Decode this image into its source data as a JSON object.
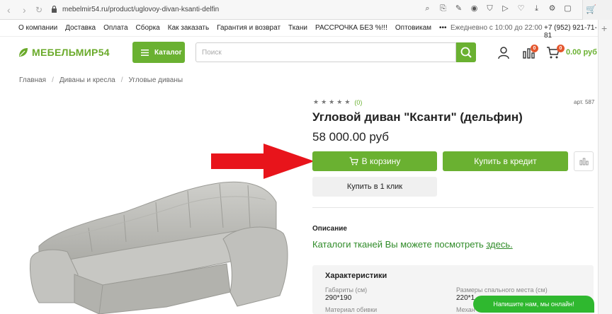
{
  "browser": {
    "url": "mebelmir54.ru/product/uglovoy-divan-ksanti-delfin",
    "back_icon": "back-icon",
    "forward_icon": "forward-icon",
    "reload_icon": "reload-icon"
  },
  "topnav": {
    "links": [
      "О компании",
      "Доставка",
      "Оплата",
      "Сборка",
      "Как заказать",
      "Гарантия и возврат",
      "Ткани",
      "РАССРОЧКА БЕЗ %!!!",
      "Оптовикам",
      "•••"
    ],
    "hours": "Ежедневно с 10:00 до 22:00",
    "phone": "+7 (952) 921-71-81"
  },
  "header": {
    "logo_text": "МЕБЕЛЬМИР54",
    "catalog_label": "Каталог",
    "search_placeholder": "Поиск",
    "compare_badge": "0",
    "cart_badge": "0",
    "cart_sum": "0.00 руб"
  },
  "breadcrumb": [
    "Главная",
    "Диваны и кресла",
    "Угловые диваны"
  ],
  "product": {
    "rating_count": "(0)",
    "rating_stars": 0,
    "sku": "арт. 587",
    "title": "Угловой диван \"Ксанти\" (дельфин)",
    "price": "58 000.00 руб",
    "add_to_cart": "В корзину",
    "buy_credit": "Купить в кредит",
    "buy_one_click": "Купить в 1 клик",
    "description_heading": "Описание",
    "description_text": "Каталоги тканей Вы можете посмотреть ",
    "description_link": "здесь.",
    "specs": {
      "heading": "Характеристики",
      "dims_label": "Габариты (см)",
      "dims_value": "290*190",
      "sleep_label": "Размеры спального места (см)",
      "sleep_value": "220*1",
      "upholstery_label": "Материал обивки",
      "mech_label": "Механ"
    }
  },
  "chat": {
    "label": "Напишите нам, мы онлайн!"
  },
  "colors": {
    "accent": "#6ab131",
    "arrow": "#e8141b",
    "badge": "#e4572e",
    "link": "#2f8b28",
    "chat": "#2fb82f"
  }
}
